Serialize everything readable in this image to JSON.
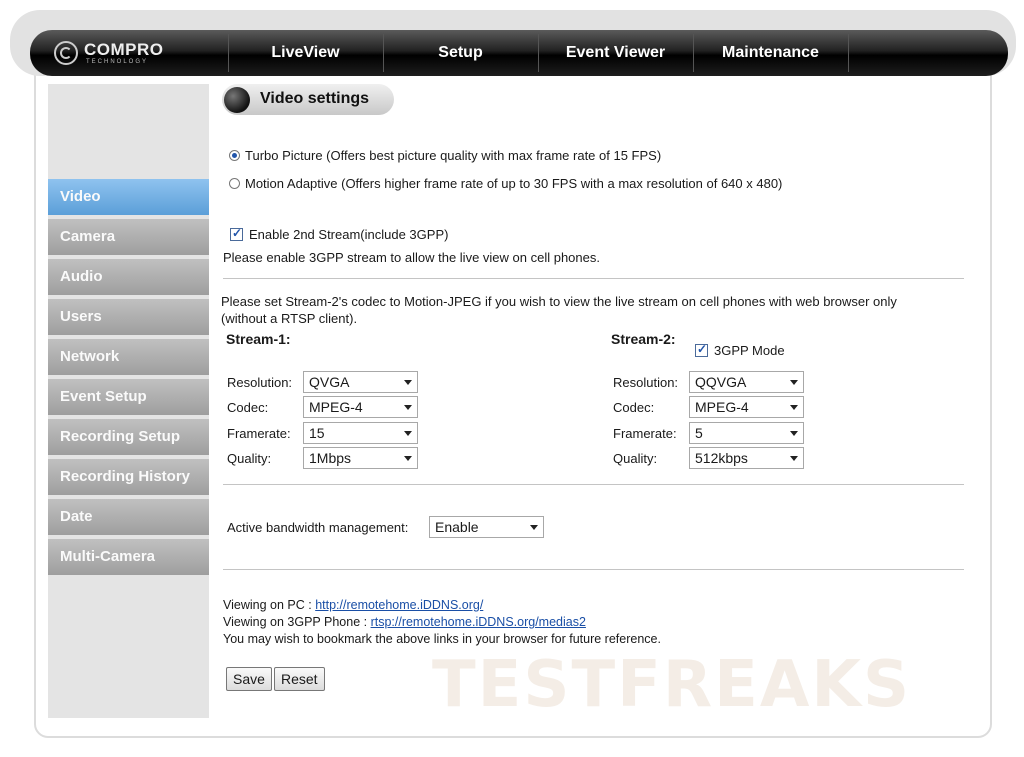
{
  "nav": {
    "logo": "COMPRO",
    "logo_sub": "TECHNOLOGY",
    "items": [
      "LiveView",
      "Setup",
      "Event Viewer",
      "Maintenance"
    ]
  },
  "sidebar": {
    "items": [
      {
        "label": "Video",
        "active": true
      },
      {
        "label": "Camera"
      },
      {
        "label": "Audio"
      },
      {
        "label": "Users"
      },
      {
        "label": "Network"
      },
      {
        "label": "Event Setup"
      },
      {
        "label": "Recording Setup"
      },
      {
        "label": "Recording History"
      },
      {
        "label": "Date"
      },
      {
        "label": "Multi-Camera"
      }
    ]
  },
  "main": {
    "title": "Video settings",
    "picture_mode": {
      "turbo_label": "Turbo Picture (Offers best picture quality with max frame rate of 15 FPS)",
      "motion_label": "Motion Adaptive (Offers higher frame rate of up to 30 FPS with a max resolution of 640 x 480)",
      "selected": "turbo"
    },
    "second_stream": {
      "label": "Enable 2nd Stream(include 3GPP)",
      "checked": true,
      "hint": "Please enable 3GPP stream to allow the live view on cell phones."
    },
    "codec_note_1": "Please set Stream-2's codec to Motion-JPEG if you wish to view the live stream on cell phones with web browser only",
    "codec_note_2": "(without a RTSP client).",
    "stream1": {
      "heading": "Stream-1:",
      "resolution_label": "Resolution:",
      "resolution": "QVGA",
      "codec_label": "Codec:",
      "codec": "MPEG-4",
      "framerate_label": "Framerate:",
      "framerate": "15",
      "quality_label": "Quality:",
      "quality": "1Mbps"
    },
    "stream2": {
      "heading": "Stream-2:",
      "gpp_label": "3GPP Mode",
      "gpp_checked": true,
      "resolution_label": "Resolution:",
      "resolution": "QQVGA",
      "codec_label": "Codec:",
      "codec": "MPEG-4",
      "framerate_label": "Framerate:",
      "framerate": "5",
      "quality_label": "Quality:",
      "quality": "512kbps"
    },
    "bandwidth": {
      "label": "Active bandwidth management:",
      "value": "Enable"
    },
    "links": {
      "pc_label": "Viewing on PC : ",
      "pc_url": "http://remotehome.iDDNS.org/",
      "phone_label": "Viewing on 3GPP Phone : ",
      "phone_url": "rtsp://remotehome.iDDNS.org/medias2",
      "bookmark_note": "You may wish to bookmark the above links in your browser for future reference."
    },
    "save_label": "Save",
    "reset_label": "Reset"
  },
  "watermark": "TESTFREAKS"
}
